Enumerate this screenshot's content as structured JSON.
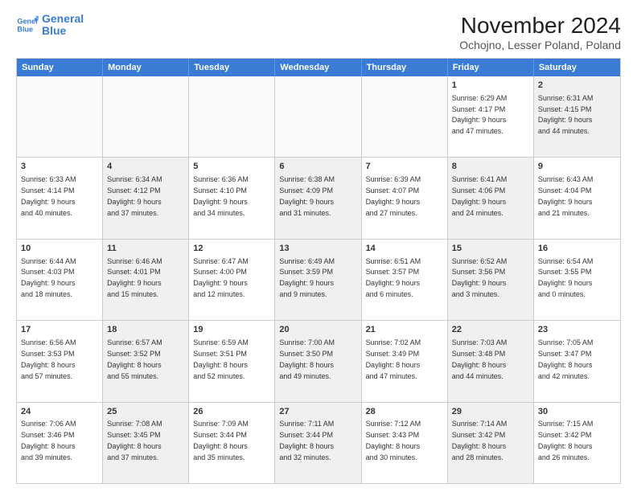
{
  "logo": {
    "line1": "General",
    "line2": "Blue"
  },
  "title": "November 2024",
  "subtitle": "Ochojno, Lesser Poland, Poland",
  "header": {
    "days": [
      "Sunday",
      "Monday",
      "Tuesday",
      "Wednesday",
      "Thursday",
      "Friday",
      "Saturday"
    ]
  },
  "rows": [
    [
      {
        "day": "",
        "info": "",
        "shaded": false,
        "empty": true
      },
      {
        "day": "",
        "info": "",
        "shaded": false,
        "empty": true
      },
      {
        "day": "",
        "info": "",
        "shaded": false,
        "empty": true
      },
      {
        "day": "",
        "info": "",
        "shaded": false,
        "empty": true
      },
      {
        "day": "",
        "info": "",
        "shaded": false,
        "empty": true
      },
      {
        "day": "1",
        "info": "Sunrise: 6:29 AM\nSunset: 4:17 PM\nDaylight: 9 hours\nand 47 minutes.",
        "shaded": false,
        "empty": false
      },
      {
        "day": "2",
        "info": "Sunrise: 6:31 AM\nSunset: 4:15 PM\nDaylight: 9 hours\nand 44 minutes.",
        "shaded": true,
        "empty": false
      }
    ],
    [
      {
        "day": "3",
        "info": "Sunrise: 6:33 AM\nSunset: 4:14 PM\nDaylight: 9 hours\nand 40 minutes.",
        "shaded": false,
        "empty": false
      },
      {
        "day": "4",
        "info": "Sunrise: 6:34 AM\nSunset: 4:12 PM\nDaylight: 9 hours\nand 37 minutes.",
        "shaded": true,
        "empty": false
      },
      {
        "day": "5",
        "info": "Sunrise: 6:36 AM\nSunset: 4:10 PM\nDaylight: 9 hours\nand 34 minutes.",
        "shaded": false,
        "empty": false
      },
      {
        "day": "6",
        "info": "Sunrise: 6:38 AM\nSunset: 4:09 PM\nDaylight: 9 hours\nand 31 minutes.",
        "shaded": true,
        "empty": false
      },
      {
        "day": "7",
        "info": "Sunrise: 6:39 AM\nSunset: 4:07 PM\nDaylight: 9 hours\nand 27 minutes.",
        "shaded": false,
        "empty": false
      },
      {
        "day": "8",
        "info": "Sunrise: 6:41 AM\nSunset: 4:06 PM\nDaylight: 9 hours\nand 24 minutes.",
        "shaded": true,
        "empty": false
      },
      {
        "day": "9",
        "info": "Sunrise: 6:43 AM\nSunset: 4:04 PM\nDaylight: 9 hours\nand 21 minutes.",
        "shaded": false,
        "empty": false
      }
    ],
    [
      {
        "day": "10",
        "info": "Sunrise: 6:44 AM\nSunset: 4:03 PM\nDaylight: 9 hours\nand 18 minutes.",
        "shaded": false,
        "empty": false
      },
      {
        "day": "11",
        "info": "Sunrise: 6:46 AM\nSunset: 4:01 PM\nDaylight: 9 hours\nand 15 minutes.",
        "shaded": true,
        "empty": false
      },
      {
        "day": "12",
        "info": "Sunrise: 6:47 AM\nSunset: 4:00 PM\nDaylight: 9 hours\nand 12 minutes.",
        "shaded": false,
        "empty": false
      },
      {
        "day": "13",
        "info": "Sunrise: 6:49 AM\nSunset: 3:59 PM\nDaylight: 9 hours\nand 9 minutes.",
        "shaded": true,
        "empty": false
      },
      {
        "day": "14",
        "info": "Sunrise: 6:51 AM\nSunset: 3:57 PM\nDaylight: 9 hours\nand 6 minutes.",
        "shaded": false,
        "empty": false
      },
      {
        "day": "15",
        "info": "Sunrise: 6:52 AM\nSunset: 3:56 PM\nDaylight: 9 hours\nand 3 minutes.",
        "shaded": true,
        "empty": false
      },
      {
        "day": "16",
        "info": "Sunrise: 6:54 AM\nSunset: 3:55 PM\nDaylight: 9 hours\nand 0 minutes.",
        "shaded": false,
        "empty": false
      }
    ],
    [
      {
        "day": "17",
        "info": "Sunrise: 6:56 AM\nSunset: 3:53 PM\nDaylight: 8 hours\nand 57 minutes.",
        "shaded": false,
        "empty": false
      },
      {
        "day": "18",
        "info": "Sunrise: 6:57 AM\nSunset: 3:52 PM\nDaylight: 8 hours\nand 55 minutes.",
        "shaded": true,
        "empty": false
      },
      {
        "day": "19",
        "info": "Sunrise: 6:59 AM\nSunset: 3:51 PM\nDaylight: 8 hours\nand 52 minutes.",
        "shaded": false,
        "empty": false
      },
      {
        "day": "20",
        "info": "Sunrise: 7:00 AM\nSunset: 3:50 PM\nDaylight: 8 hours\nand 49 minutes.",
        "shaded": true,
        "empty": false
      },
      {
        "day": "21",
        "info": "Sunrise: 7:02 AM\nSunset: 3:49 PM\nDaylight: 8 hours\nand 47 minutes.",
        "shaded": false,
        "empty": false
      },
      {
        "day": "22",
        "info": "Sunrise: 7:03 AM\nSunset: 3:48 PM\nDaylight: 8 hours\nand 44 minutes.",
        "shaded": true,
        "empty": false
      },
      {
        "day": "23",
        "info": "Sunrise: 7:05 AM\nSunset: 3:47 PM\nDaylight: 8 hours\nand 42 minutes.",
        "shaded": false,
        "empty": false
      }
    ],
    [
      {
        "day": "24",
        "info": "Sunrise: 7:06 AM\nSunset: 3:46 PM\nDaylight: 8 hours\nand 39 minutes.",
        "shaded": false,
        "empty": false
      },
      {
        "day": "25",
        "info": "Sunrise: 7:08 AM\nSunset: 3:45 PM\nDaylight: 8 hours\nand 37 minutes.",
        "shaded": true,
        "empty": false
      },
      {
        "day": "26",
        "info": "Sunrise: 7:09 AM\nSunset: 3:44 PM\nDaylight: 8 hours\nand 35 minutes.",
        "shaded": false,
        "empty": false
      },
      {
        "day": "27",
        "info": "Sunrise: 7:11 AM\nSunset: 3:44 PM\nDaylight: 8 hours\nand 32 minutes.",
        "shaded": true,
        "empty": false
      },
      {
        "day": "28",
        "info": "Sunrise: 7:12 AM\nSunset: 3:43 PM\nDaylight: 8 hours\nand 30 minutes.",
        "shaded": false,
        "empty": false
      },
      {
        "day": "29",
        "info": "Sunrise: 7:14 AM\nSunset: 3:42 PM\nDaylight: 8 hours\nand 28 minutes.",
        "shaded": true,
        "empty": false
      },
      {
        "day": "30",
        "info": "Sunrise: 7:15 AM\nSunset: 3:42 PM\nDaylight: 8 hours\nand 26 minutes.",
        "shaded": false,
        "empty": false
      }
    ]
  ]
}
